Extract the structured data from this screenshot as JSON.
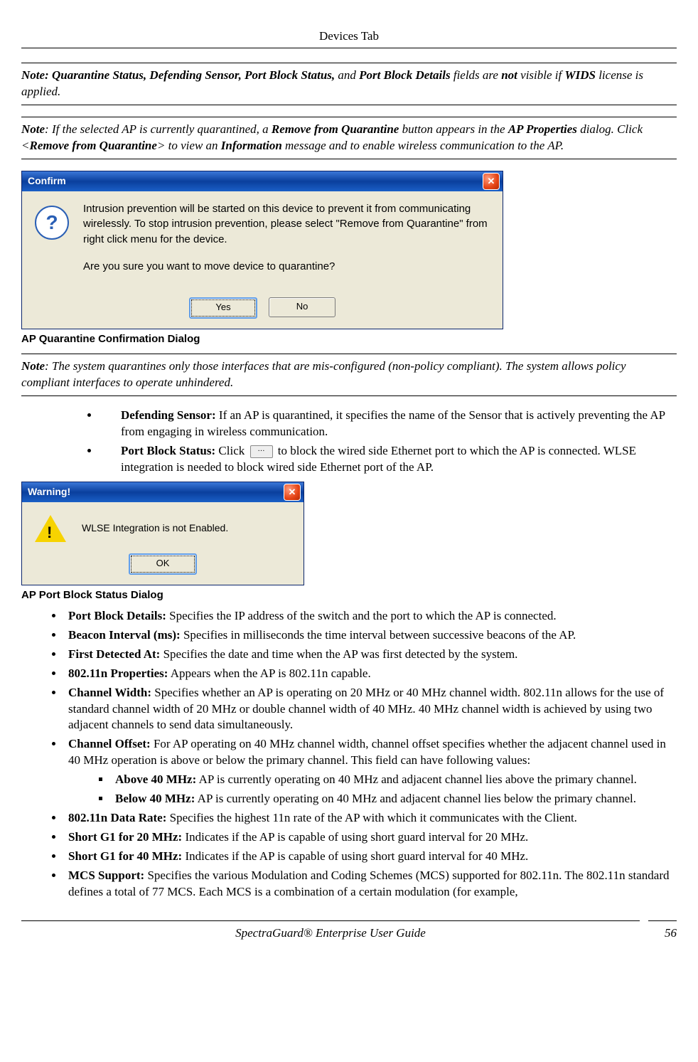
{
  "header": "Devices Tab",
  "note1_prefix": "Note: Quarantine Status, Defending Sensor, Port Block Status,",
  "note1_mid": " and ",
  "note1_b2": "Port Block Details",
  "note1_tail1": " fields are ",
  "note1_not": "not",
  "note1_tail2": " visible if ",
  "note1_wids": "WIDS",
  "note1_tail3": " license is applied.",
  "note2_lead": "Note",
  "note2_a": ": If the selected AP is currently quarantined, a ",
  "note2_b1": "Remove from Quarantine",
  "note2_c": " button appears in the ",
  "note2_b2": "AP Properties",
  "note2_d": " dialog. Click <",
  "note2_b3": "Remove from Quarantine",
  "note2_e": "> to view an ",
  "note2_b4": "Information",
  "note2_f": " message and to enable wireless communication to the AP.",
  "confirm": {
    "title": "Confirm",
    "line1": "Intrusion prevention will be started on this device to prevent it from communicating wirelessly. To stop intrusion prevention, please select \"Remove from Quarantine\" from right click menu for the device.",
    "line2": "Are you sure you want to move device to quarantine?",
    "yes": "Yes",
    "no": "No"
  },
  "caption1": "AP Quarantine Confirmation Dialog",
  "note3_lead": "Note",
  "note3_body": ": The system quarantines only those interfaces that are mis-configured (non-policy compliant). The system allows policy compliant interfaces to operate unhindered.",
  "li_def_b": "Defending Sensor:",
  "li_def_t": " If an AP is quarantined, it specifies the name of the Sensor that is actively preventing the AP from engaging in wireless communication.",
  "li_pbs_b": "Port Block Status:",
  "li_pbs_t1": " Click ",
  "li_pbs_t2": " to block the wired side Ethernet port to which the AP is connected. WLSE integration is needed to block wired side Ethernet port of the AP.",
  "warn": {
    "title": "Warning!",
    "msg": "WLSE Integration is not Enabled.",
    "ok": "OK"
  },
  "caption2": "AP Port Block Status Dialog",
  "li2": {
    "pbd_b": "Port Block Details:",
    "pbd_t": " Specifies the IP address of the switch and the port to which the AP is connected.",
    "bi_b": "Beacon Interval (ms):",
    "bi_t": " Specifies in milliseconds the time interval between successive beacons of the AP.",
    "fd_b": "First Detected At:",
    "fd_t": " Specifies the date and time when the AP was first detected by the system.",
    "np_b": "802.11n Properties:",
    "np_t": " Appears when the AP is 802.11n capable.",
    "cw_b": "Channel Width:",
    "cw_t": " Specifies whether an AP is operating on 20 MHz or 40 MHz channel width. 802.11n allows for the use of standard channel width of 20 MHz or double channel width of 40 MHz. 40 MHz channel width is achieved by using two adjacent channels to send data simultaneously.",
    "co_b": "Channel Offset:",
    "co_t": " For AP operating on 40 MHz channel width, channel offset specifies whether the adjacent channel used in 40 MHz operation is above or below the primary channel. This field can have following values:",
    "ab_b": "Above 40 MHz:",
    "ab_t": " AP is currently operating on 40 MHz and adjacent channel lies above the primary channel.",
    "be_b": "Below 40 MHz:",
    "be_t": " AP is currently operating on 40 MHz and adjacent channel lies below the primary channel.",
    "dr_b": "802.11n Data Rate:",
    "dr_t": " Specifies the highest 11n rate of the AP with which it communicates with the Client.",
    "sg20_b": "Short G1 for 20 MHz:",
    "sg20_t": " Indicates if the AP is capable of using short guard interval for 20 MHz.",
    "sg40_b": "Short G1 for 40 MHz:",
    "sg40_t": " Indicates if the AP is capable of using short guard interval for 40 MHz.",
    "mcs_b": "MCS Support:",
    "mcs_t": " Specifies the various Modulation and Coding Schemes (MCS) supported for 802.11n. The 802.11n standard defines a total of 77 MCS. Each MCS is a combination of a certain modulation (for example,"
  },
  "footer_text": "SpectraGuard®  Enterprise User Guide",
  "page_num": "56"
}
